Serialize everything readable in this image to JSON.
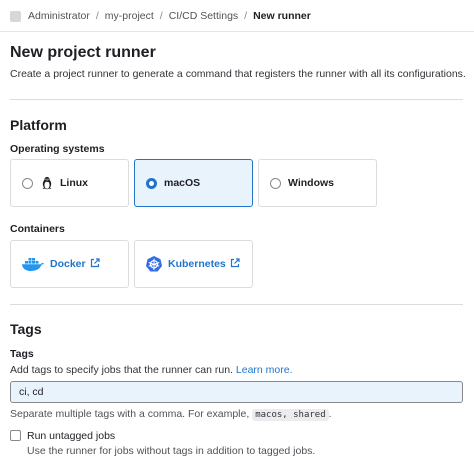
{
  "breadcrumb": {
    "items": [
      "Administrator",
      "my-project",
      "CI/CD Settings",
      "New runner"
    ]
  },
  "page": {
    "title": "New project runner",
    "subtitle": "Create a project runner to generate a command that registers the runner with all its configurations."
  },
  "platform": {
    "heading": "Platform",
    "os_label": "Operating systems",
    "os_options": [
      {
        "label": "Linux",
        "icon": "linux-penguin-icon",
        "selected": false
      },
      {
        "label": "macOS",
        "icon": "",
        "selected": true
      },
      {
        "label": "Windows",
        "icon": "",
        "selected": false
      }
    ],
    "containers_label": "Containers",
    "containers": [
      {
        "label": "Docker",
        "icon": "docker-whale-icon"
      },
      {
        "label": "Kubernetes",
        "icon": "kubernetes-helm-icon"
      }
    ]
  },
  "tags": {
    "heading": "Tags",
    "label": "Tags",
    "help_text": "Add tags to specify jobs that the runner can run.",
    "learn_more": "Learn more.",
    "input_value": "ci, cd",
    "separator_help_prefix": "Separate multiple tags with a comma. For example,",
    "example_code": "macos, shared",
    "separator_help_suffix": ".",
    "run_untagged_label": "Run untagged jobs",
    "run_untagged_help": "Use the runner for jobs without tags in addition to tagged jobs.",
    "run_untagged_checked": false
  },
  "colors": {
    "accent": "#1f75cb",
    "selected_bg": "#e9f3fc",
    "docker_blue": "#2496ed",
    "kubernetes_blue": "#326ce5"
  }
}
